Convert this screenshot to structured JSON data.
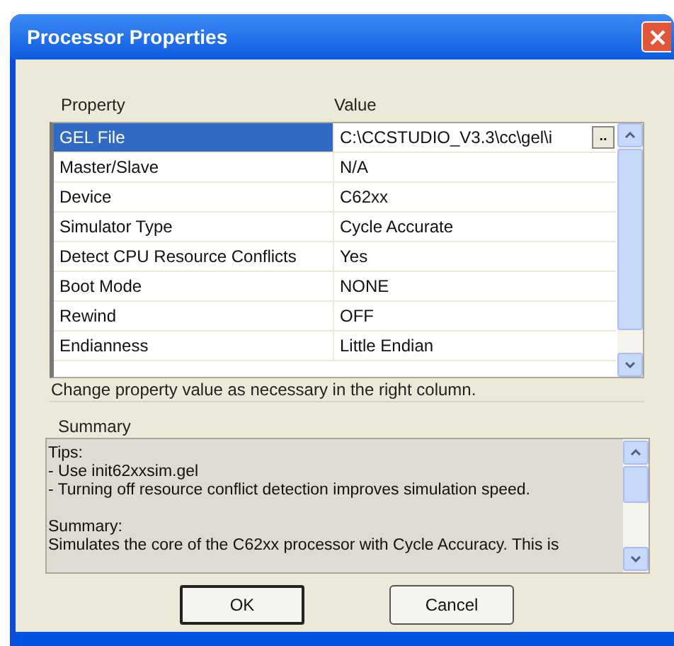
{
  "window": {
    "title": "Processor Properties"
  },
  "table": {
    "columns": [
      "Property",
      "Value"
    ],
    "rows": [
      {
        "property": "GEL File",
        "value": "C:\\CCSTUDIO_V3.3\\cc\\gel\\i",
        "browse_button": "..",
        "selected": true
      },
      {
        "property": "Master/Slave",
        "value": "N/A",
        "selected": false
      },
      {
        "property": "Device",
        "value": "C62xx",
        "selected": false
      },
      {
        "property": "Simulator Type",
        "value": "Cycle Accurate",
        "selected": false
      },
      {
        "property": "Detect CPU Resource Conflicts",
        "value": "Yes",
        "selected": false
      },
      {
        "property": "Boot Mode",
        "value": "NONE",
        "selected": false
      },
      {
        "property": "Rewind",
        "value": "OFF",
        "selected": false
      },
      {
        "property": "Endianness",
        "value": "Little Endian",
        "selected": false
      }
    ]
  },
  "hint": "Change property value as necessary in the right column.",
  "summary": {
    "label": "Summary",
    "paragraphs": [
      [
        "Tips:",
        "- Use init62xxsim.gel",
        "- Turning off resource conflict detection improves simulation speed."
      ],
      [
        "Summary:",
        "Simulates the core of the C62xx processor with Cycle Accuracy. This is"
      ]
    ]
  },
  "buttons": [
    {
      "label": "OK",
      "default": true
    },
    {
      "label": "Cancel",
      "default": false
    }
  ]
}
